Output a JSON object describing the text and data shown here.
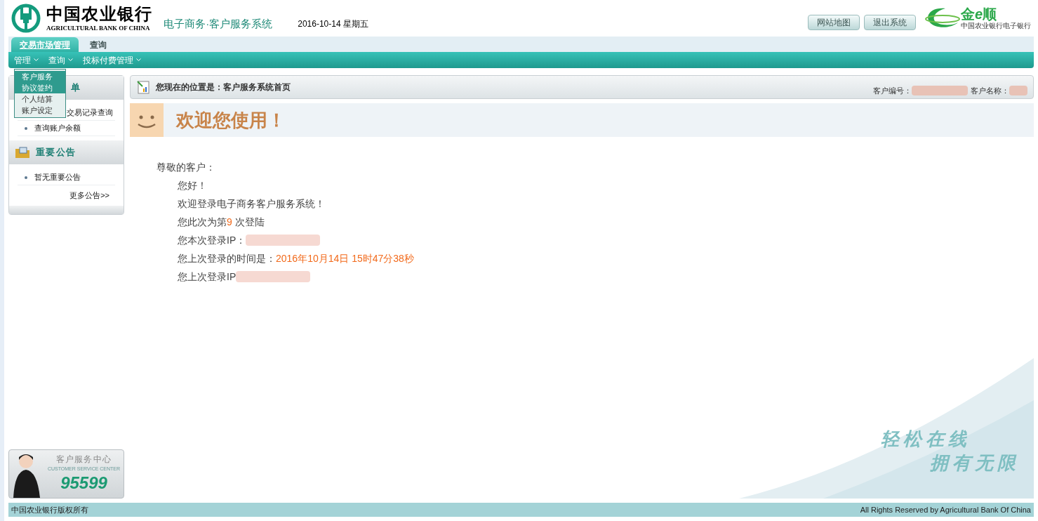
{
  "header": {
    "bank_name": "中国农业银行",
    "bank_name_en": "AGRICULTURAL BANK OF CHINA",
    "system_title": "电子商务·客户服务系统",
    "date": "2016-10-14 星期五",
    "buttons": [
      "网站地图",
      "退出系统"
    ],
    "brand": {
      "name_left": "金",
      "name_mid": "e",
      "name_right": "顺",
      "tagline": "中国农业银行电子银行"
    }
  },
  "tabs": [
    {
      "label": "交易市场管理",
      "selected": true
    },
    {
      "label": "查询",
      "selected": false
    }
  ],
  "menu": [
    {
      "label": "管理"
    },
    {
      "label": "查询"
    },
    {
      "label": "投标付费管理"
    }
  ],
  "dropdown": [
    {
      "label": "客户服务",
      "selected": true
    },
    {
      "label": "协议签约",
      "selected": true
    },
    {
      "label": "个人结算",
      "selected": false
    },
    {
      "label": "账户设定",
      "selected": false
    }
  ],
  "sidebar": {
    "sections": [
      {
        "title": "单",
        "items": [
          "交易记录查询",
          "查询账户余额"
        ]
      },
      {
        "title": "重要公告",
        "items": [
          "暂无重要公告"
        ],
        "more": "更多公告>>"
      }
    ],
    "service": {
      "title": "客户服务中心",
      "subtitle": "CUSTOMER SERVICE CENTER",
      "phone": "95599"
    }
  },
  "breadcrumb": {
    "text": "您现在的位置是：客户服务系统首页",
    "customer_id_label": "客户编号：",
    "customer_name_label": "客户名称："
  },
  "welcome": {
    "title": "欢迎您使用！",
    "greeting": "尊敬的客户：",
    "lines": [
      {
        "segments": [
          {
            "kind": "text",
            "text": "您好！"
          }
        ]
      },
      {
        "segments": [
          {
            "kind": "text",
            "text": "欢迎登录电子商务客户服务系统！"
          }
        ]
      },
      {
        "segments": [
          {
            "kind": "text",
            "text": "您此次为第"
          },
          {
            "kind": "highlight",
            "text": "9"
          },
          {
            "kind": "text",
            "text": " 次登陆"
          }
        ]
      },
      {
        "segments": [
          {
            "kind": "text",
            "text": "您本次登录IP："
          }
        ],
        "hidden_value": {
          "kind": "redacted"
        }
      },
      {
        "segments": [
          {
            "kind": "text",
            "text": "您上次登录的时间是："
          },
          {
            "kind": "highlight",
            "text": "2016年10月14日 15时47分38秒"
          }
        ]
      },
      {
        "segments": [
          {
            "kind": "text",
            "text": "您上次登录IP"
          }
        ],
        "hidden_value": {
          "kind": "redacted"
        }
      }
    ]
  },
  "slogan": [
    "轻松在线",
    "拥有无限"
  ],
  "footer": {
    "left": "中国农业银行版权所有",
    "right": "All Rights Reserved by Agricultural Bank Of China"
  }
}
